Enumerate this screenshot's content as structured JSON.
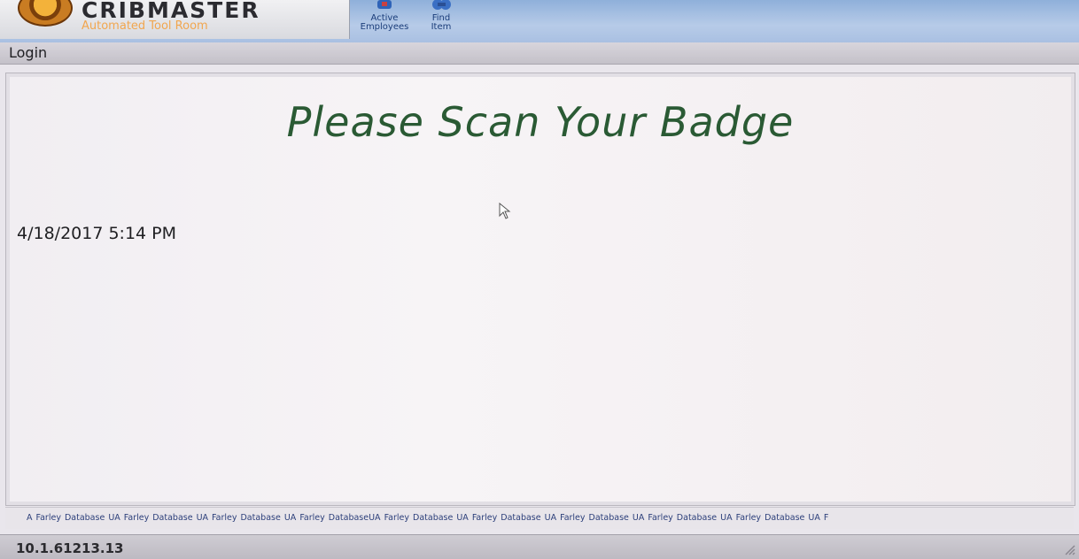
{
  "app": {
    "brand_name": "CRIBMASTER",
    "brand_tagline": "Automated Tool Room"
  },
  "toolbar": {
    "items": [
      {
        "label_line1": "Active",
        "label_line2": "Employees",
        "icon": "employees-icon"
      },
      {
        "label_line1": "Find",
        "label_line2": "Item",
        "icon": "find-item-icon"
      }
    ]
  },
  "login_bar": {
    "label": "Login"
  },
  "main": {
    "prompt": "Please Scan Your Badge",
    "datetime": "4/18/2017 5:14 PM"
  },
  "ticker": {
    "text": "A Farley Database   UA Farley Database   UA Farley Database   UA Farley DatabaseUA Farley Database   UA Farley Database   UA Farley Database   UA Farley Database   UA Farley Database   UA F"
  },
  "status": {
    "ip": "10.1.61213.13"
  },
  "colors": {
    "prompt": "#2a5a34",
    "tagline": "#f1a64f",
    "toolbar_bg": "#a9c0e2"
  }
}
